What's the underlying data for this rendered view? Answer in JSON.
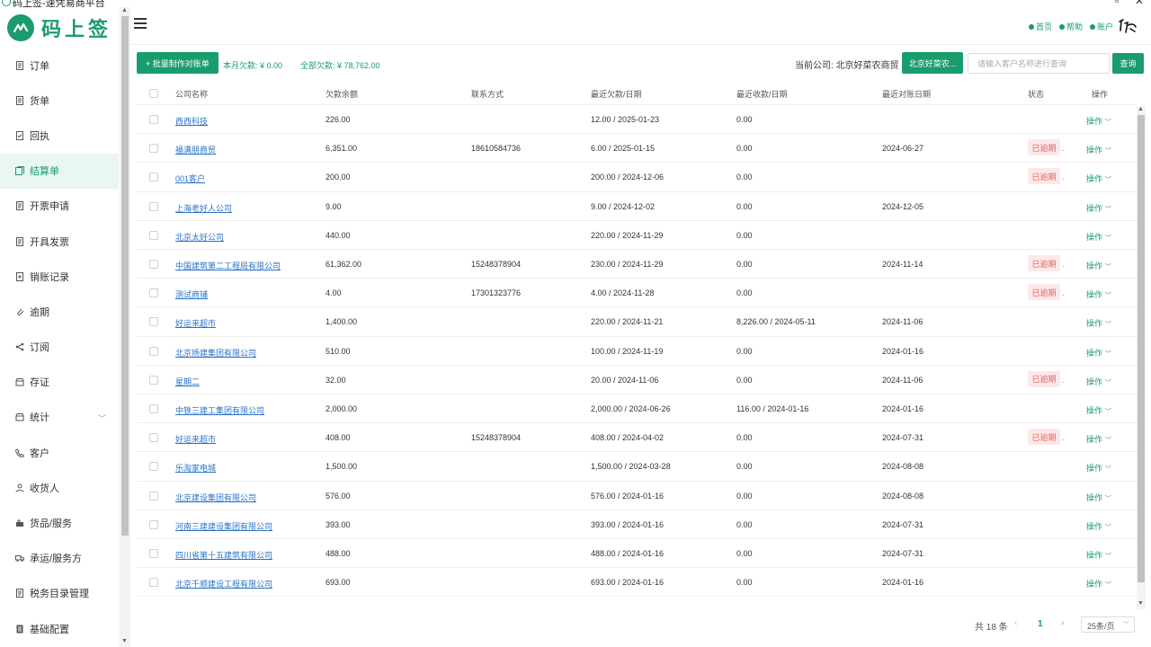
{
  "window": {
    "title": "码上签-速凭易商平台"
  },
  "brand": {
    "logo_text": "码上签",
    "accent": "#1a9c6d"
  },
  "sidebar": {
    "items": [
      {
        "label": "订单",
        "icon": "document-icon"
      },
      {
        "label": "货单",
        "icon": "document-icon"
      },
      {
        "label": "回执",
        "icon": "receipt-icon"
      },
      {
        "label": "结算单",
        "icon": "settlement-icon",
        "active": true
      },
      {
        "label": "开票申请",
        "icon": "document-icon"
      },
      {
        "label": "开具发票",
        "icon": "document-icon"
      },
      {
        "label": "销账记录",
        "icon": "record-icon"
      },
      {
        "label": "逾期",
        "icon": "clip-icon"
      },
      {
        "label": "订阅",
        "icon": "share-icon"
      },
      {
        "label": "存证",
        "icon": "archive-icon"
      },
      {
        "label": "统计",
        "icon": "stats-icon",
        "expandable": true
      },
      {
        "label": "客户",
        "icon": "phone-icon"
      },
      {
        "label": "收货人",
        "icon": "user-icon"
      },
      {
        "label": "货品/服务",
        "icon": "goods-icon"
      },
      {
        "label": "承运/服务方",
        "icon": "truck-icon"
      },
      {
        "label": "税务目录管理",
        "icon": "document-icon"
      },
      {
        "label": "基础配置",
        "icon": "config-icon"
      }
    ]
  },
  "header": {
    "links": [
      {
        "label": "首页",
        "icon": "home-icon"
      },
      {
        "label": "帮助",
        "icon": "help-icon"
      },
      {
        "label": "账户",
        "icon": "account-icon"
      }
    ]
  },
  "toolbar": {
    "batch_button": "+ 批量制作对账单",
    "month_debt": "本月欠款: ¥ 0.00",
    "total_debt": "全部欠款: ¥ 78,762.00",
    "current_company": "当前公司: 北京好菜农商贸",
    "company_button": "北京好菜农...",
    "search_placeholder": "请输入客户名称进行查询",
    "search_button": "查询"
  },
  "table": {
    "headers": [
      "公司名称",
      "欠款余额",
      "联系方式",
      "最近欠款/日期",
      "最近收款/日期",
      "最近对账日期",
      "状态",
      "操作"
    ],
    "op_label": "操作",
    "overdue_label": "已逾期",
    "rows": [
      {
        "name": "西西科技",
        "balance": "226.00",
        "contact": "",
        "last_debt": "12.00 / 2025-01-23",
        "last_receipt": "0.00",
        "last_recon": "",
        "overdue": false
      },
      {
        "name": "福满朋商贸",
        "balance": "6,351.00",
        "contact": "18610584736",
        "last_debt": "6.00 / 2025-01-15",
        "last_receipt": "0.00",
        "last_recon": "2024-06-27",
        "overdue": true
      },
      {
        "name": "001客户",
        "balance": "200.00",
        "contact": "",
        "last_debt": "200.00 / 2024-12-06",
        "last_receipt": "0.00",
        "last_recon": "",
        "overdue": true
      },
      {
        "name": "上海老好人公司",
        "balance": "9.00",
        "contact": "",
        "last_debt": "9.00 / 2024-12-02",
        "last_receipt": "0.00",
        "last_recon": "2024-12-05",
        "overdue": false
      },
      {
        "name": "北京太好公司",
        "balance": "440.00",
        "contact": "",
        "last_debt": "220.00 / 2024-11-29",
        "last_receipt": "0.00",
        "last_recon": "",
        "overdue": false
      },
      {
        "name": "中国建筑第二工程局有限公司",
        "balance": "61,362.00",
        "contact": "15248378904",
        "last_debt": "230.00 / 2024-11-29",
        "last_receipt": "0.00",
        "last_recon": "2024-11-14",
        "overdue": true
      },
      {
        "name": "测试商铺",
        "balance": "4.00",
        "contact": "17301323776",
        "last_debt": "4.00 / 2024-11-28",
        "last_receipt": "0.00",
        "last_recon": "",
        "overdue": true
      },
      {
        "name": "好运来超市",
        "balance": "1,400.00",
        "contact": "",
        "last_debt": "220.00 / 2024-11-21",
        "last_receipt": "8,226.00 / 2024-05-11",
        "last_recon": "2024-11-06",
        "overdue": false
      },
      {
        "name": "北京扬建集团有限公司",
        "balance": "510.00",
        "contact": "",
        "last_debt": "100.00 / 2024-11-19",
        "last_receipt": "0.00",
        "last_recon": "2024-01-16",
        "overdue": false
      },
      {
        "name": "星期二",
        "balance": "32.00",
        "contact": "",
        "last_debt": "20.00 / 2024-11-06",
        "last_receipt": "0.00",
        "last_recon": "2024-11-06",
        "overdue": true
      },
      {
        "name": "中铁三建工集团有限公司",
        "balance": "2,000.00",
        "contact": "",
        "last_debt": "2,000.00 / 2024-06-26",
        "last_receipt": "116.00 / 2024-01-16",
        "last_recon": "2024-01-16",
        "overdue": false
      },
      {
        "name": "好运来超市",
        "balance": "408.00",
        "contact": "15248378904",
        "last_debt": "408.00 / 2024-04-02",
        "last_receipt": "0.00",
        "last_recon": "2024-07-31",
        "overdue": true
      },
      {
        "name": "乐淘家电城",
        "balance": "1,500.00",
        "contact": "",
        "last_debt": "1,500.00 / 2024-03-28",
        "last_receipt": "0.00",
        "last_recon": "2024-08-08",
        "overdue": false
      },
      {
        "name": "北京建设集团有限公司",
        "balance": "576.00",
        "contact": "",
        "last_debt": "576.00 / 2024-01-16",
        "last_receipt": "0.00",
        "last_recon": "2024-08-08",
        "overdue": false
      },
      {
        "name": "河南三建建设集团有限公司",
        "balance": "393.00",
        "contact": "",
        "last_debt": "393.00 / 2024-01-16",
        "last_receipt": "0.00",
        "last_recon": "2024-07-31",
        "overdue": false
      },
      {
        "name": "四川省第十五建筑有限公司",
        "balance": "488.00",
        "contact": "",
        "last_debt": "488.00 / 2024-01-16",
        "last_receipt": "0.00",
        "last_recon": "2024-07-31",
        "overdue": false
      },
      {
        "name": "北京千顺建设工程有限公司",
        "balance": "693.00",
        "contact": "",
        "last_debt": "693.00 / 2024-01-16",
        "last_receipt": "0.00",
        "last_recon": "2024-01-16",
        "overdue": false
      }
    ]
  },
  "pagination": {
    "total": "共 18 条",
    "current_page": "1",
    "page_size": "25条/页"
  }
}
